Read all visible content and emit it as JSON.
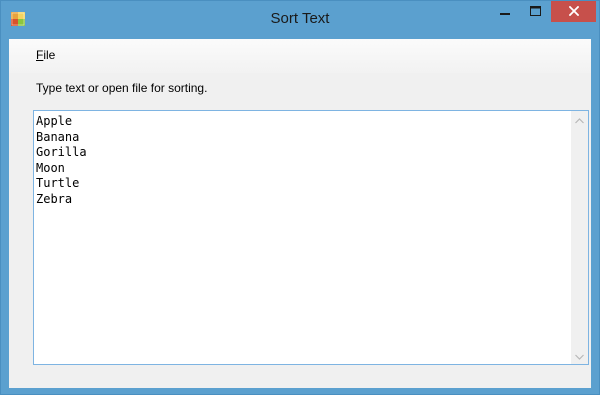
{
  "window": {
    "title": "Sort Text",
    "icons": {
      "app": "application-icon",
      "minimize": "minimize-icon",
      "maximize": "maximize-icon",
      "close": "close-icon"
    }
  },
  "menu": {
    "items": [
      {
        "label_mnemonic": "F",
        "label_rest": "ile"
      }
    ]
  },
  "prompt": "Type text or open file for sorting.",
  "editor": {
    "text": "Apple\nBanana\nGorilla\nMoon\nTurtle\nZebra"
  },
  "colors": {
    "titlebar": "#5ba0cf",
    "close_button": "#c7504b",
    "textbox_border": "#7eb4e2",
    "client_background": "#f0f0f0"
  }
}
